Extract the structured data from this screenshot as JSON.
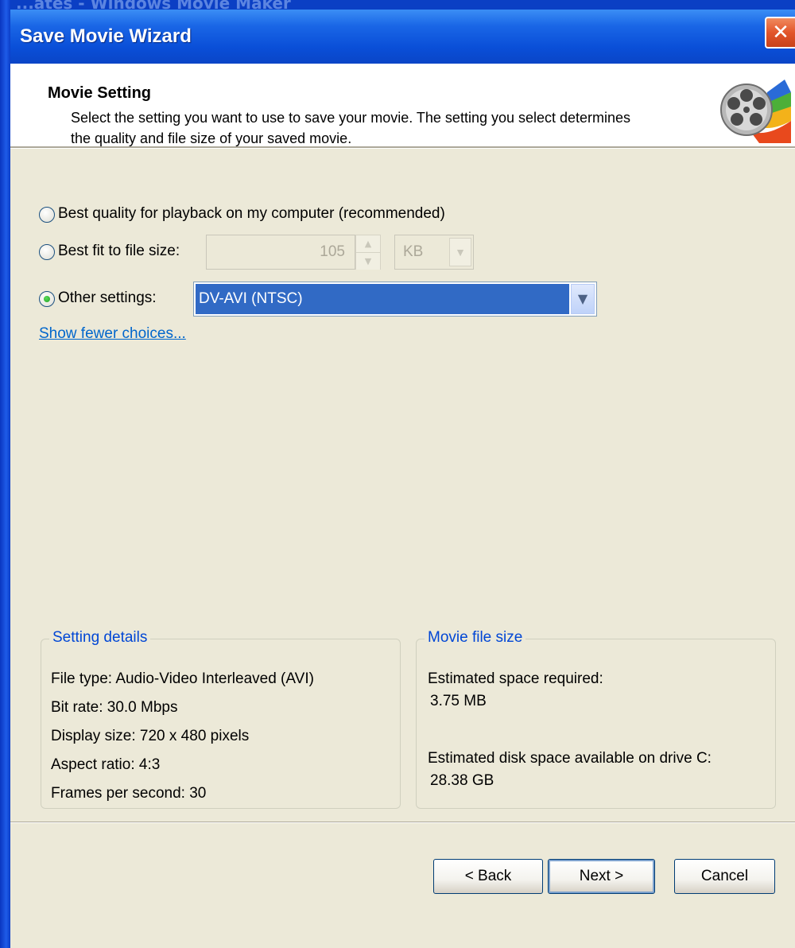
{
  "background_window_title": "...ates - Windows Movie Maker",
  "window": {
    "title": "Save Movie Wizard",
    "close_symbol": "✕"
  },
  "header": {
    "title": "Movie Setting",
    "description": "Select the setting you want to use to save your movie. The setting you select determines the quality and file size of your saved movie.",
    "icon": "film-reel-icon"
  },
  "options": {
    "best_quality_label": "Best quality for playback on my computer (recommended)",
    "best_fit_label": "Best fit to file size:",
    "best_fit_value": "105",
    "best_fit_unit": "KB",
    "other_label": "Other settings:",
    "other_value": "DV-AVI (NTSC)",
    "selected": "other"
  },
  "show_fewer_link": "Show fewer choices...",
  "setting_details": {
    "title": "Setting details",
    "lines": [
      "File type: Audio-Video Interleaved (AVI)",
      "Bit rate: 30.0 Mbps",
      "Display size: 720 x 480 pixels",
      "Aspect ratio: 4:3",
      "Frames per second: 30"
    ]
  },
  "movie_file_size": {
    "title": "Movie file size",
    "estimated_label": "Estimated space required:",
    "estimated_value": "3.75 MB",
    "available_label": "Estimated disk space available on drive C:",
    "available_value": "28.38 GB"
  },
  "buttons": {
    "back": "< Back",
    "next": "Next >",
    "cancel": "Cancel"
  },
  "colors": {
    "title_bar": "#0A4FD8",
    "selection": "#316AC5",
    "link": "#0066CC",
    "group_legend": "#0046D5",
    "dialog_bg": "#ECE9D8"
  }
}
